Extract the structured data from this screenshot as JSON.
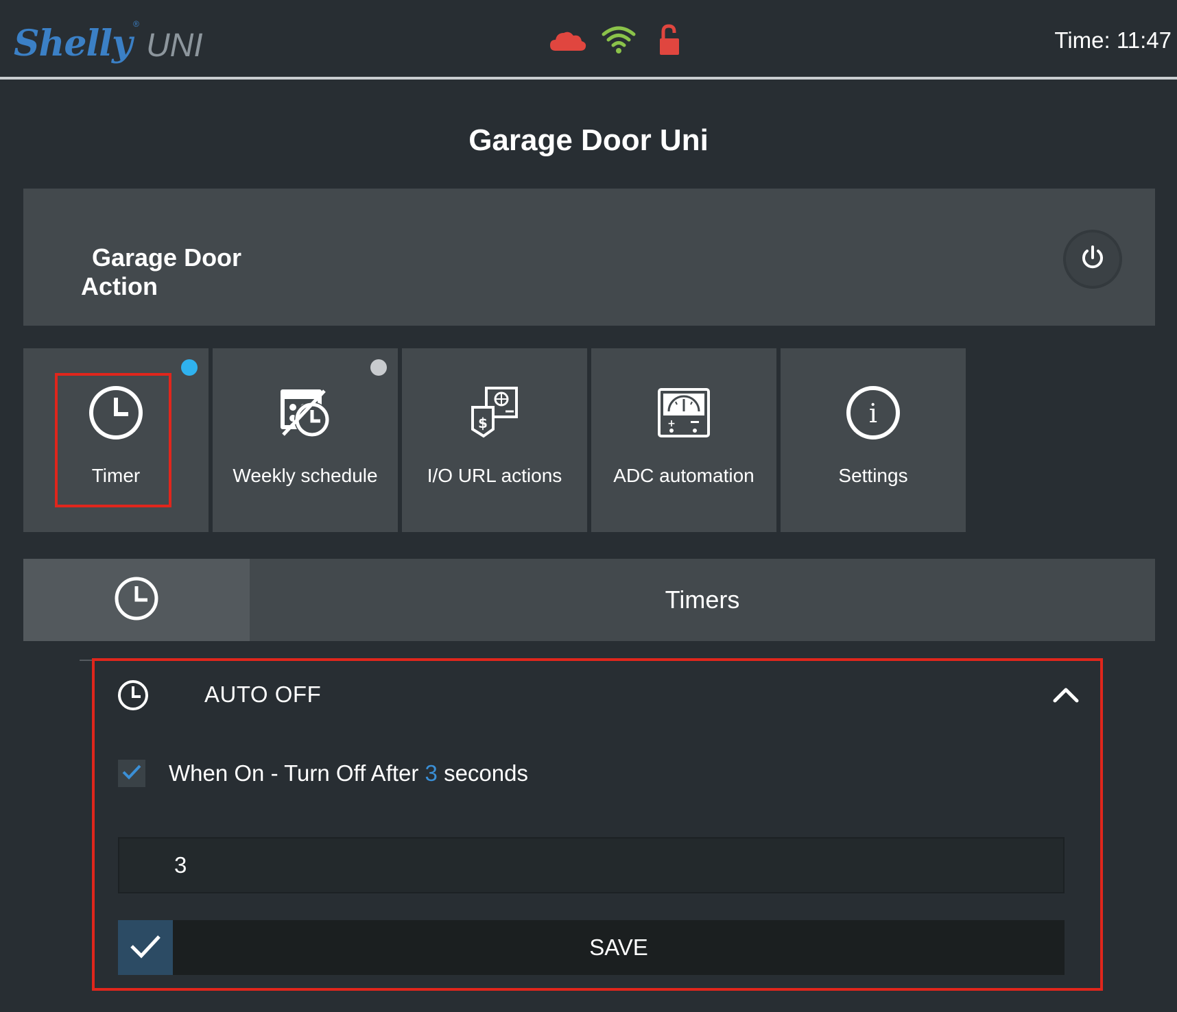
{
  "header": {
    "logo_script": "Shelly",
    "logo_reg": "®",
    "logo_product": "UNI",
    "time": "Time: 11:47",
    "status_icons": [
      "cloud-icon",
      "wifi-icon",
      "unlocked-padlock-icon"
    ]
  },
  "page_title": "Garage Door Uni",
  "action": {
    "title_line1": "Garage Door",
    "title_line2": "Action",
    "power_icon": "power-icon"
  },
  "tiles": [
    {
      "label": "Timer",
      "icon": "clock-icon",
      "dot_color": "#2fb2ef"
    },
    {
      "label": "Weekly schedule",
      "icon": "schedule-icon",
      "dot_color": "#c8cbce"
    },
    {
      "label": "I/O URL actions",
      "icon": "url-actions-icon"
    },
    {
      "label": "ADC automation",
      "icon": "gauge-icon"
    },
    {
      "label": "Settings",
      "icon": "info-icon"
    }
  ],
  "timers_bar": {
    "title": "Timers",
    "icon": "clock-icon"
  },
  "auto_off": {
    "title": "AUTO OFF",
    "checkbox_checked": true,
    "text_before": "When On - Turn Off After",
    "value": "3",
    "text_after": "seconds",
    "input_value": "3",
    "save_label": "SAVE"
  },
  "colors": {
    "background": "#282e33",
    "panel": "#43494d",
    "highlight": "#e0261c",
    "accent_blue": "#3a8fd6",
    "cloud": "#e0463f",
    "wifi": "#8bc34a",
    "lock": "#e0463f"
  }
}
